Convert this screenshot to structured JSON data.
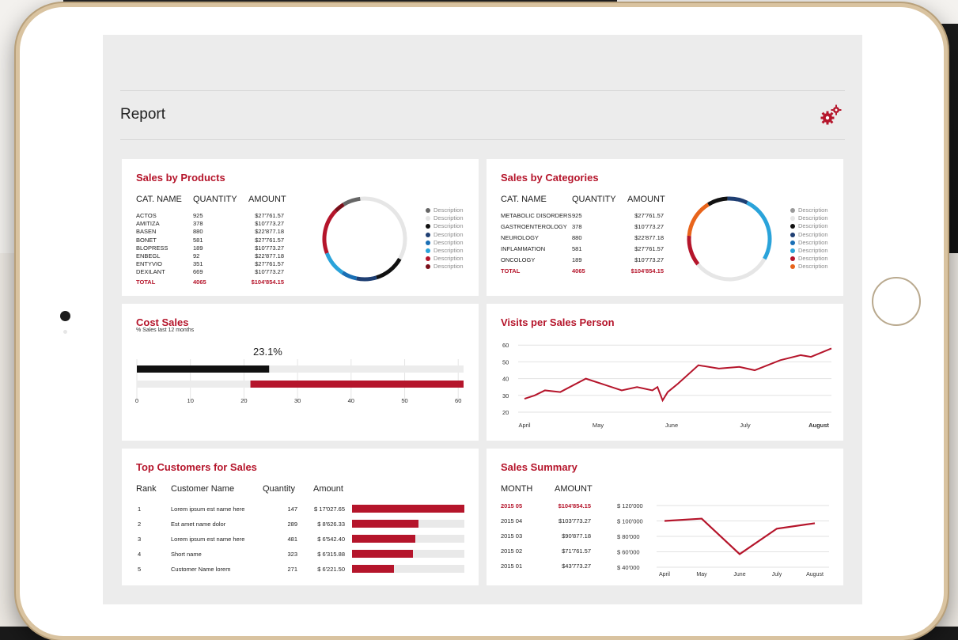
{
  "page": {
    "title": "Report"
  },
  "colors": {
    "accent": "#b5152b",
    "gray": "#e9e9e9"
  },
  "sales_by_products": {
    "title": "Sales by Products",
    "headers": [
      "CAT. NAME",
      "QUANTITY",
      "AMOUNT"
    ],
    "rows": [
      [
        "ACTOS",
        "925",
        "$27'761.57"
      ],
      [
        "AMITIZA",
        "378",
        "$10'773.27"
      ],
      [
        "BASEN",
        "880",
        "$22'877.18"
      ],
      [
        "BONET",
        "581",
        "$27'761.57"
      ],
      [
        "BLOPRESS",
        "189",
        "$10'773.27"
      ],
      [
        "ENBEGL",
        "92",
        "$22'877.18"
      ],
      [
        "ENTYVIO",
        "351",
        "$27'761.57"
      ],
      [
        "DEXILANT",
        "669",
        "$10'773.27"
      ]
    ],
    "total": [
      "TOTAL",
      "4065",
      "$104'854.15"
    ],
    "legend": [
      {
        "label": "Description",
        "color": "#666666"
      },
      {
        "label": "Description",
        "color": "#e6e6e6"
      },
      {
        "label": "Description",
        "color": "#111111"
      },
      {
        "label": "Description",
        "color": "#1f3f73"
      },
      {
        "label": "Description",
        "color": "#1a6fb5"
      },
      {
        "label": "Description",
        "color": "#2aa3da"
      },
      {
        "label": "Description",
        "color": "#b5152b"
      },
      {
        "label": "Description",
        "color": "#7a0f1a"
      }
    ]
  },
  "sales_by_categories": {
    "title": "Sales by Categories",
    "headers": [
      "CAT. NAME",
      "QUANTITY",
      "AMOUNT"
    ],
    "rows": [
      [
        "METABOLIC DISORDERS",
        "925",
        "$27'761.57"
      ],
      [
        "GASTROENTEROLOGY",
        "378",
        "$10'773.27"
      ],
      [
        "NEUROLOGY",
        "880",
        "$22'877.18"
      ],
      [
        "INFLAMMATION",
        "581",
        "$27'761.57"
      ],
      [
        "ONCOLOGY",
        "189",
        "$10'773.27"
      ]
    ],
    "total": [
      "TOTAL",
      "4065",
      "$104'854.15"
    ],
    "legend": [
      {
        "label": "Description",
        "color": "#9a9a9a"
      },
      {
        "label": "Description",
        "color": "#e6e6e6"
      },
      {
        "label": "Description",
        "color": "#111111"
      },
      {
        "label": "Description",
        "color": "#1f3f73"
      },
      {
        "label": "Description",
        "color": "#1a6fb5"
      },
      {
        "label": "Description",
        "color": "#2aa3da"
      },
      {
        "label": "Description",
        "color": "#b5152b"
      },
      {
        "label": "Description",
        "color": "#e8641b"
      }
    ]
  },
  "cost_sales": {
    "title": "Cost Sales",
    "subtitle": "% Sales last 12 months",
    "value_label": "23.1%",
    "ticks": [
      "0",
      "10",
      "20",
      "30",
      "40",
      "50",
      "60"
    ]
  },
  "visits": {
    "title": "Visits per Sales Person"
  },
  "top_customers": {
    "title": "Top Customers for Sales",
    "headers": [
      "Rank",
      "Customer Name",
      "Quantity",
      "Amount"
    ],
    "rows": [
      [
        "1",
        "Lorem ipsum est name here",
        "147",
        "$ 17'027.65"
      ],
      [
        "2",
        "Est amet name dolor",
        "289",
        "$ 8'626.33"
      ],
      [
        "3",
        "Lorem ipsum est name here",
        "481",
        "$ 6'542.40"
      ],
      [
        "4",
        "Short name",
        "323",
        "$ 6'315.88"
      ],
      [
        "5",
        "Customer Name lorem",
        "271",
        "$ 6'221.50"
      ]
    ]
  },
  "sales_summary": {
    "title": "Sales Summary",
    "headers": [
      "MONTH",
      "AMOUNT"
    ],
    "rows": [
      [
        "2015 05",
        "$104'854.15"
      ],
      [
        "2015 04",
        "$103'773.27"
      ],
      [
        "2015 03",
        "$90'877.18"
      ],
      [
        "2015 02",
        "$71'761.57"
      ],
      [
        "2015 01",
        "$43'773.27"
      ]
    ]
  },
  "chart_data": [
    {
      "type": "pie",
      "title": "Sales by Products",
      "donut": true,
      "labels": [
        "ACTOS",
        "AMITIZA",
        "BASEN",
        "BONET",
        "BLOPRESS",
        "ENBEGL",
        "ENTYVIO",
        "DEXILANT"
      ],
      "colors": [
        "#666666",
        "#e6e6e6",
        "#111111",
        "#1f3f73",
        "#1a6fb5",
        "#2aa3da",
        "#b5152b",
        "#7a0f1a"
      ],
      "values": [
        7,
        35,
        12,
        8,
        6,
        10,
        18,
        4
      ]
    },
    {
      "type": "pie",
      "title": "Sales by Categories",
      "donut": true,
      "labels": [
        "METABOLIC DISORDERS",
        "GASTROENTEROLOGY",
        "NEUROLOGY",
        "INFLAMMATION",
        "ONCOLOGY"
      ],
      "colors": [
        "#111111",
        "#1f3f73",
        "#2aa3da",
        "#e6e6e6",
        "#b5152b",
        "#e8641b"
      ],
      "values": [
        8,
        8,
        26,
        31,
        12,
        15
      ]
    },
    {
      "type": "bar",
      "title": "Cost Sales",
      "orientation": "horizontal",
      "xlim": [
        0,
        61
      ],
      "xticks": [
        0,
        10,
        20,
        30,
        40,
        50,
        60
      ],
      "series": [
        {
          "values": [
            24.7
          ],
          "color": "#111111"
        },
        {
          "start": 21.2,
          "values": [
            61
          ],
          "color": "#b5152b"
        }
      ],
      "annotation": "23.1%"
    },
    {
      "type": "line",
      "title": "Visits per Sales Person",
      "x_labels": [
        "April",
        "May",
        "June",
        "July",
        "August"
      ],
      "ylim": [
        20,
        62
      ],
      "yticks": [
        20,
        30,
        40,
        50,
        60
      ],
      "x": [
        0,
        0.2,
        0.4,
        0.7,
        1.2,
        1.9,
        2.2,
        2.5,
        2.6,
        2.7,
        2.8,
        3.0,
        3.4,
        3.8,
        4.2,
        4.5,
        5.0,
        5.4,
        5.6,
        6.0
      ],
      "y": [
        28,
        30,
        33,
        32,
        40,
        33,
        35,
        33,
        35,
        27,
        32,
        37,
        48,
        46,
        47,
        45,
        51,
        54,
        53,
        58
      ],
      "color": "#b5152b"
    },
    {
      "type": "bar",
      "title": "Top Customers for Sales",
      "orientation": "horizontal",
      "categories": [
        "1",
        "2",
        "3",
        "4",
        "5"
      ],
      "values": [
        17027.65,
        8626.33,
        6542.4,
        6315.88,
        6221.5
      ],
      "display_fraction": [
        1.0,
        0.59,
        0.56,
        0.54,
        0.37
      ],
      "color": "#b5152b"
    },
    {
      "type": "line",
      "title": "Sales Summary",
      "x_labels": [
        "April",
        "May",
        "June",
        "July",
        "August"
      ],
      "ylim": [
        40000,
        120000
      ],
      "yticks": [
        "$ 40'000",
        "$ 60'000",
        "$ 80'000",
        "$ 100'000",
        "$ 120'000"
      ],
      "values": [
        100000,
        103000,
        57000,
        90000,
        97000
      ],
      "color": "#b5152b"
    }
  ]
}
